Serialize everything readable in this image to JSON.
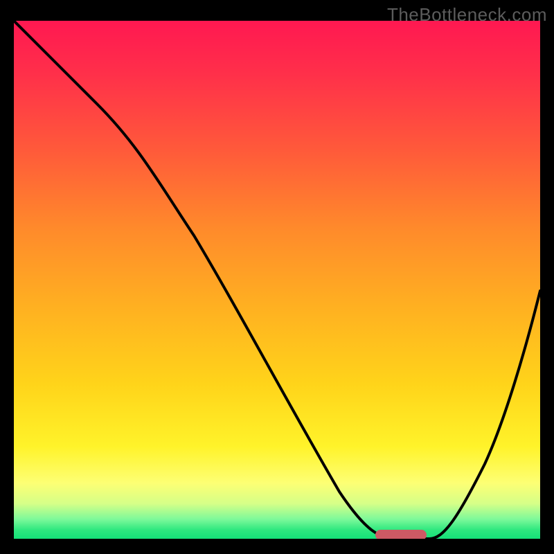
{
  "watermark": "TheBottleneck.com",
  "colors": {
    "background": "#000000",
    "curve": "#000000",
    "marker": "#cd5964",
    "gradient_top": "#ff1851",
    "gradient_bottom": "#11df77"
  },
  "chart_data": {
    "type": "line",
    "title": "",
    "xlabel": "",
    "ylabel": "",
    "xlim": [
      0,
      100
    ],
    "ylim": [
      0,
      100
    ],
    "x": [
      0,
      5,
      10,
      15,
      20,
      25,
      30,
      35,
      40,
      45,
      50,
      55,
      60,
      65,
      70,
      72,
      75,
      80,
      85,
      90,
      95,
      100
    ],
    "values": [
      100,
      96,
      92,
      88,
      84,
      78,
      71,
      63,
      55,
      47,
      39,
      30,
      21,
      12,
      3,
      0,
      0,
      3,
      12,
      24,
      36,
      48
    ],
    "marker_segment": {
      "x_start": 70,
      "x_end": 79,
      "y": 0
    },
    "notes": "Gradient background red→green top→bottom; black V-shaped curve with minimum around x≈72–78; small rounded marker on x-axis at the minimum."
  }
}
